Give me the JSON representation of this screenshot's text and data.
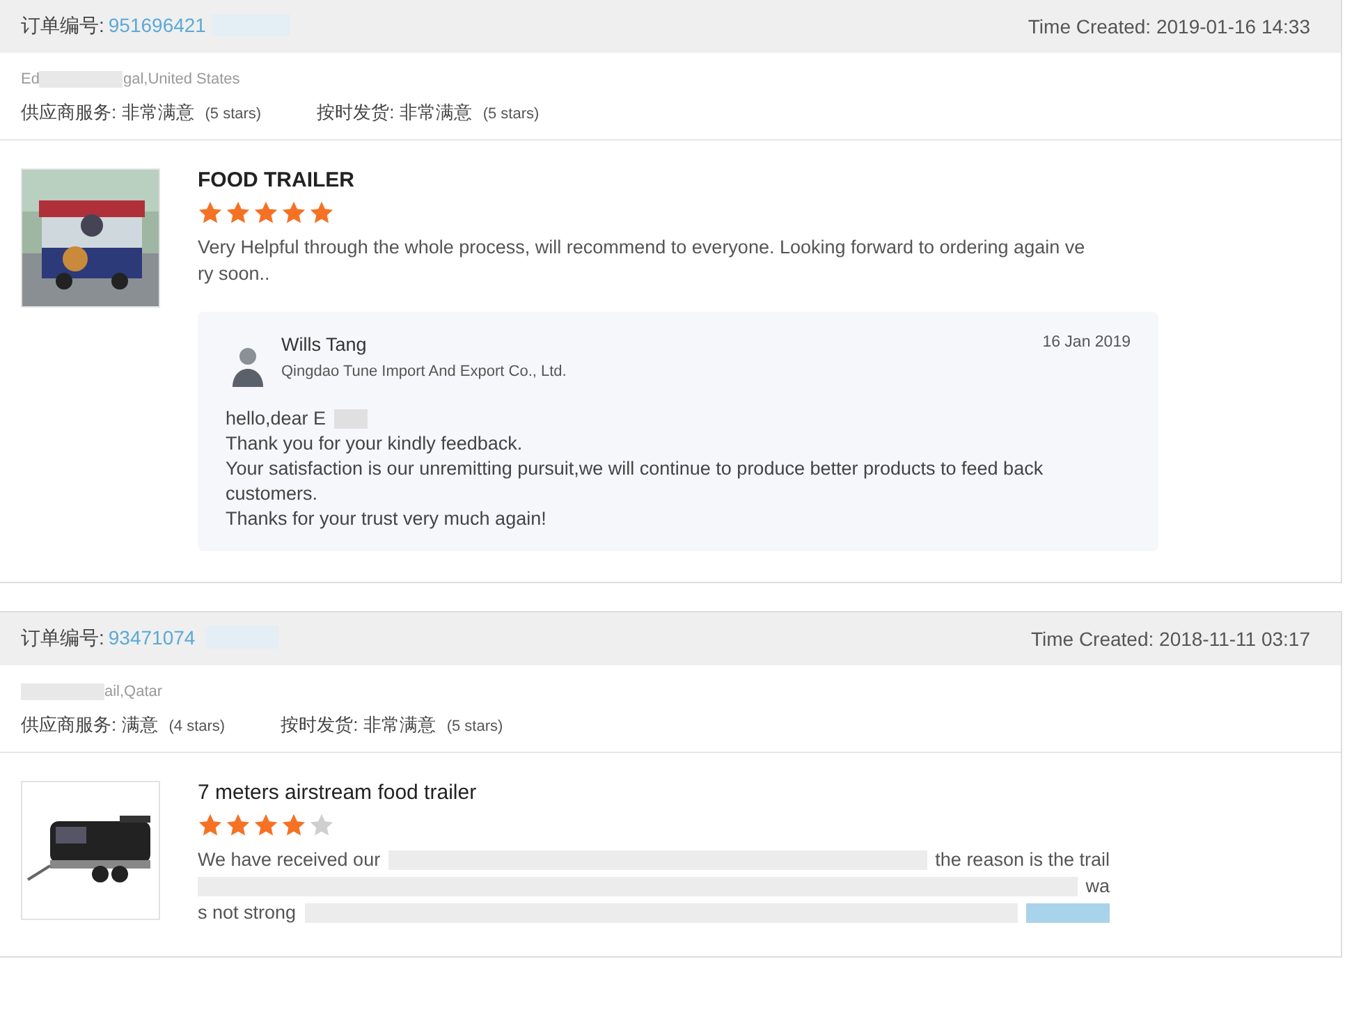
{
  "orders": [
    {
      "order_label": "订单编号:",
      "order_number": "951696421",
      "order_number_blurred": true,
      "time_created": "Time Created: 2019-01-16 14:33",
      "location": [
        {
          "kind": "text",
          "text": "Ed"
        },
        {
          "kind": "blur"
        },
        {
          "kind": "text",
          "text": "gal,United States"
        }
      ],
      "ratings": [
        {
          "label": "供应商服务:",
          "value": "非常满意",
          "count": "(5 stars)"
        },
        {
          "label": "按时发货:",
          "value": "非常满意",
          "count": "(5 stars)"
        }
      ],
      "product": {
        "title": "FOOD TRAILER",
        "title_bold": true,
        "stars": 5,
        "comment": [
          [
            {
              "kind": "text",
              "text": "Very Helpful through the whole process, will recommend to everyone. Looking forward to ordering again ve"
            }
          ],
          [
            {
              "kind": "text",
              "text": "ry soon.."
            }
          ]
        ],
        "reply": {
          "name": "Wills Tang",
          "company": "Qingdao Tune Import And Export Co., Ltd.",
          "date": "16 Jan 2019",
          "lines": [
            [
              {
                "kind": "text",
                "text": "hello,dear E"
              },
              {
                "kind": "blur"
              }
            ],
            [
              {
                "kind": "text",
                "text": "Thank you for your kindly feedback."
              }
            ],
            [
              {
                "kind": "text",
                "text": "Your satisfaction is our unremitting pursuit,we will continue to produce better products to feed back"
              }
            ],
            [
              {
                "kind": "text",
                "text": "customers."
              }
            ],
            [
              {
                "kind": "text",
                "text": "Thanks for your trust very much again!"
              }
            ]
          ]
        }
      }
    },
    {
      "order_label": "订单编号:",
      "order_number": "93471074",
      "order_number_blurred": true,
      "time_created": "Time Created: 2018-11-11 03:17",
      "location": [
        {
          "kind": "blur"
        },
        {
          "kind": "text",
          "text": "ail,Qatar"
        }
      ],
      "ratings": [
        {
          "label": "供应商服务:",
          "value": "满意",
          "count": "(4 stars)"
        },
        {
          "label": "按时发货:",
          "value": "非常满意",
          "count": "(5 stars)"
        }
      ],
      "product": {
        "title": "7 meters airstream food trailer",
        "title_bold": false,
        "stars": 4,
        "comment": [
          [
            {
              "kind": "text",
              "text": "We have received our"
            },
            {
              "kind": "blur"
            },
            {
              "kind": "text",
              "text": "the reason is the trail"
            }
          ],
          [
            {
              "kind": "blur"
            },
            {
              "kind": "text",
              "text": "wa"
            }
          ],
          [
            {
              "kind": "text",
              "text": "s not strong"
            },
            {
              "kind": "blur"
            },
            {
              "kind": "link-blur"
            }
          ]
        ]
      }
    }
  ]
}
